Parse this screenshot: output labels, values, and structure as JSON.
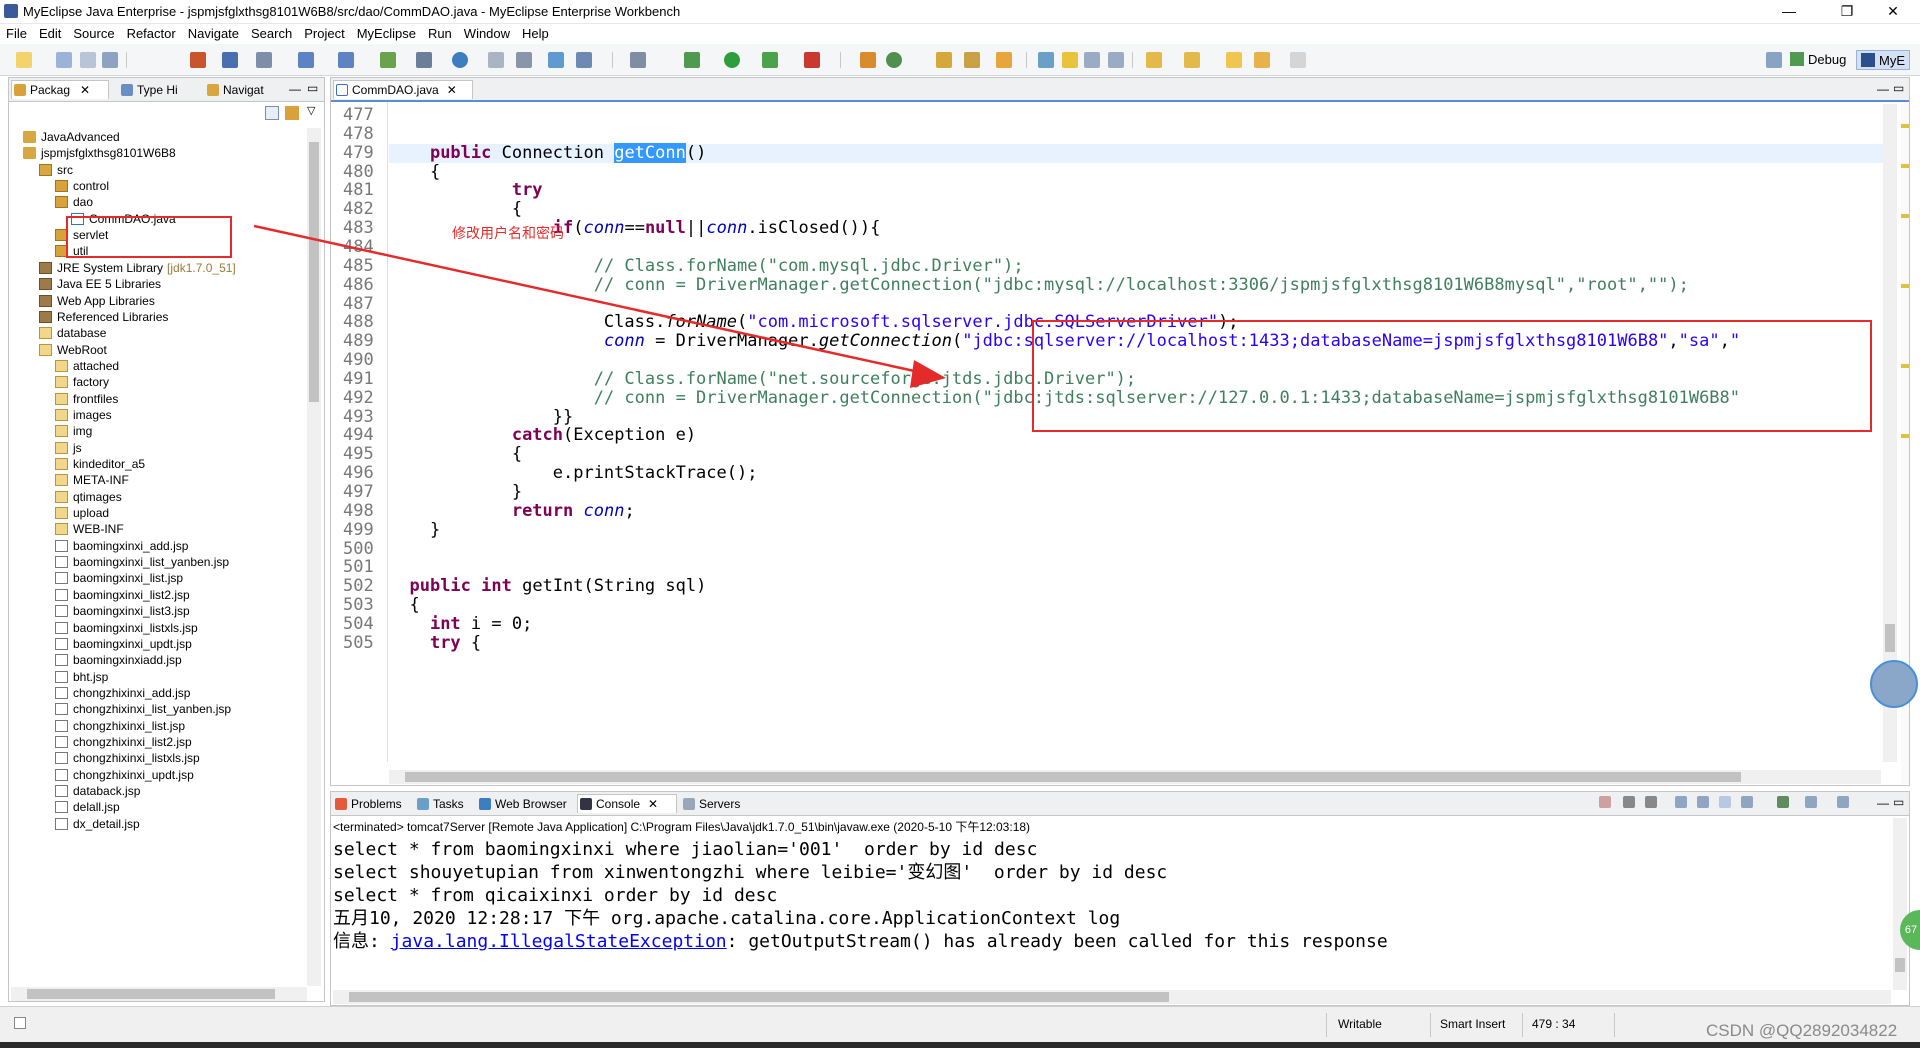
{
  "window": {
    "title": "MyEclipse Java Enterprise - jspmjsfglxthsg8101W6B8/src/dao/CommDAO.java - MyEclipse Enterprise Workbench",
    "min": "—",
    "max": "❐",
    "close": "✕"
  },
  "menu": [
    "File",
    "Edit",
    "Source",
    "Refactor",
    "Navigate",
    "Search",
    "Project",
    "MyEclipse",
    "Run",
    "Window",
    "Help"
  ],
  "perspectives": {
    "debug": "Debug",
    "myeclipse": "MyE"
  },
  "left_pane": {
    "tabs": [
      "Packag",
      "Type Hi",
      "Navigat"
    ],
    "tree": [
      {
        "label": "JavaAdvanced",
        "depth": 0,
        "icon": "proj"
      },
      {
        "label": "jspmjsfglxthsg8101W6B8",
        "depth": 0,
        "icon": "proj"
      },
      {
        "label": "src",
        "depth": 1,
        "icon": "src"
      },
      {
        "label": "control",
        "depth": 2,
        "icon": "pkg"
      },
      {
        "label": "dao",
        "depth": 2,
        "icon": "pkg"
      },
      {
        "label": "CommDAO.java",
        "depth": 3,
        "icon": "java"
      },
      {
        "label": "servlet",
        "depth": 2,
        "icon": "pkg"
      },
      {
        "label": "util",
        "depth": 2,
        "icon": "pkg"
      },
      {
        "label": "JRE System Library",
        "suffix": "[jdk1.7.0_51]",
        "depth": 1,
        "icon": "lib"
      },
      {
        "label": "Java EE 5 Libraries",
        "depth": 1,
        "icon": "lib"
      },
      {
        "label": "Web App Libraries",
        "depth": 1,
        "icon": "lib"
      },
      {
        "label": "Referenced Libraries",
        "depth": 1,
        "icon": "lib"
      },
      {
        "label": "database",
        "depth": 1,
        "icon": "fold"
      },
      {
        "label": "WebRoot",
        "depth": 1,
        "icon": "fold"
      },
      {
        "label": "attached",
        "depth": 2,
        "icon": "fold"
      },
      {
        "label": "factory",
        "depth": 2,
        "icon": "fold"
      },
      {
        "label": "frontfiles",
        "depth": 2,
        "icon": "fold"
      },
      {
        "label": "images",
        "depth": 2,
        "icon": "fold"
      },
      {
        "label": "img",
        "depth": 2,
        "icon": "fold"
      },
      {
        "label": "js",
        "depth": 2,
        "icon": "fold"
      },
      {
        "label": "kindeditor_a5",
        "depth": 2,
        "icon": "fold"
      },
      {
        "label": "META-INF",
        "depth": 2,
        "icon": "fold"
      },
      {
        "label": "qtimages",
        "depth": 2,
        "icon": "fold"
      },
      {
        "label": "upload",
        "depth": 2,
        "icon": "fold"
      },
      {
        "label": "WEB-INF",
        "depth": 2,
        "icon": "fold"
      },
      {
        "label": "baomingxinxi_add.jsp",
        "depth": 2,
        "icon": "file"
      },
      {
        "label": "baomingxinxi_list_yanben.jsp",
        "depth": 2,
        "icon": "file"
      },
      {
        "label": "baomingxinxi_list.jsp",
        "depth": 2,
        "icon": "file"
      },
      {
        "label": "baomingxinxi_list2.jsp",
        "depth": 2,
        "icon": "file"
      },
      {
        "label": "baomingxinxi_list3.jsp",
        "depth": 2,
        "icon": "file"
      },
      {
        "label": "baomingxinxi_listxls.jsp",
        "depth": 2,
        "icon": "file"
      },
      {
        "label": "baomingxinxi_updt.jsp",
        "depth": 2,
        "icon": "file"
      },
      {
        "label": "baomingxinxiadd.jsp",
        "depth": 2,
        "icon": "file"
      },
      {
        "label": "bht.jsp",
        "depth": 2,
        "icon": "file"
      },
      {
        "label": "chongzhixinxi_add.jsp",
        "depth": 2,
        "icon": "file"
      },
      {
        "label": "chongzhixinxi_list_yanben.jsp",
        "depth": 2,
        "icon": "file"
      },
      {
        "label": "chongzhixinxi_list.jsp",
        "depth": 2,
        "icon": "file"
      },
      {
        "label": "chongzhixinxi_list2.jsp",
        "depth": 2,
        "icon": "file"
      },
      {
        "label": "chongzhixinxi_listxls.jsp",
        "depth": 2,
        "icon": "file"
      },
      {
        "label": "chongzhixinxi_updt.jsp",
        "depth": 2,
        "icon": "file"
      },
      {
        "label": "databack.jsp",
        "depth": 2,
        "icon": "file"
      },
      {
        "label": "delall.jsp",
        "depth": 2,
        "icon": "file"
      },
      {
        "label": "dx_detail.jsp",
        "depth": 2,
        "icon": "file"
      }
    ]
  },
  "annotation": {
    "text": "修改用户名和密码",
    "color": "#e52a2a"
  },
  "editor": {
    "tab": "CommDAO.java",
    "first_line": 477,
    "lines": [
      "",
      "",
      "    <span class=\"kw\">public</span> Connection <span class=\"sel\">getConn</span>()",
      "    {",
      "            <span class=\"kw\">try</span>",
      "            {",
      "                <span class=\"kw\">if</span>(<span class=\"fld\">conn</span>==<span class=\"kw\">null</span>||<span class=\"fld\">conn</span>.isClosed()){",
      "",
      "                    <span class=\"cm\">// Class.forName(\"com.mysql.jdbc.Driver\");</span>",
      "                    <span class=\"cm\">// conn = DriverManager.getConnection(\"jdbc:mysql://localhost:3306/jspmjsfglxthsg8101W6B8mysql\",\"root\",\"\");</span>",
      "",
      "                     Class.<span class=\"it\">forName</span>(<span class=\"st\">\"com.microsoft.sqlserver.jdbc.SQLServerDriver\"</span>);",
      "                     <span class=\"fld\">conn</span> = DriverManager.<span class=\"it\">getConnection</span>(<span class=\"st\">\"jdbc:sqlserver://localhost:1433;databaseName=jspmjsfglxthsg8101W6B8\"</span>,<span class=\"st\">\"sa\"</span>,<span class=\"st\">\"</span>",
      "",
      "                    <span class=\"cm\">// Class.forName(\"net.sourceforge.jtds.jdbc.Driver\");</span>",
      "                    <span class=\"cm\">// conn = DriverManager.getConnection(\"jdbc:jtds:sqlserver://127.0.0.1:1433;databaseName=jspmjsfglxthsg8101W6B8\"</span>",
      "                }}",
      "            <span class=\"kw\">catch</span>(Exception e)",
      "            {",
      "                e.printStackTrace();",
      "            }",
      "            <span class=\"kw\">return</span> <span class=\"fld\">conn</span>;",
      "    }",
      "",
      "",
      "  <span class=\"kw\">public</span> <span class=\"kw\">int</span> getInt(String sql)",
      "  {",
      "    <span class=\"kw\">int</span> i = 0;",
      "    <span class=\"kw\">try</span> {"
    ]
  },
  "console": {
    "tabs": [
      "Problems",
      "Tasks",
      "Web Browser",
      "Console",
      "Servers"
    ],
    "description": "<terminated> tomcat7Server [Remote Java Application] C:\\Program Files\\Java\\jdk1.7.0_51\\bin\\javaw.exe (2020-5-10 下午12:03:18)",
    "lines": [
      "select * from baomingxinxi where jiaolian='001'  order by id desc",
      "select shouyetupian from xinwentongzhi where leibie='变幻图'  order by id desc",
      "select * from qicaixinxi order by id desc",
      "五月10, 2020 12:28:17 下午 org.apache.catalina.core.ApplicationContext log"
    ],
    "info_prefix": "信息: ",
    "exception_link": "java.lang.IllegalStateException",
    "exception_rest": ": getOutputStream() has already been called for this response"
  },
  "status": {
    "writable": "Writable",
    "insert_mode": "Smart Insert",
    "position": "479 : 34"
  },
  "watermark": "CSDN @QQ2892034822",
  "badge": "67"
}
